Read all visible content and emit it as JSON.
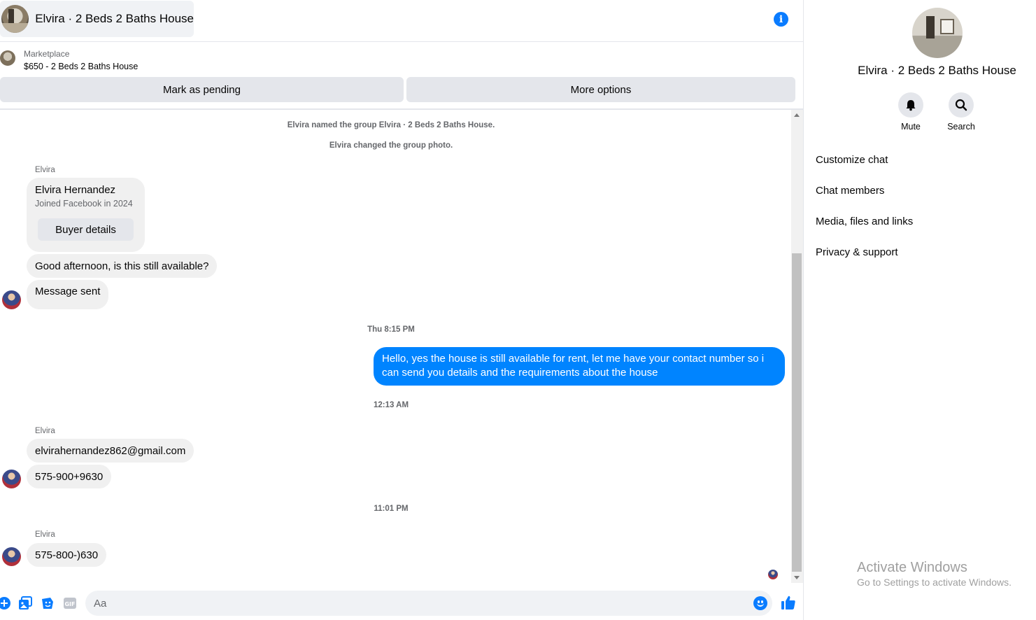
{
  "header": {
    "title": "Elvira · 2 Beds 2 Baths House"
  },
  "listing": {
    "label": "Marketplace",
    "price_title": "$650 - 2 Beds 2 Baths House"
  },
  "actions": {
    "pending_label": "Mark as pending",
    "more_label": "More options"
  },
  "messages": {
    "system_1": "Elvira named the group Elvira · 2 Beds 2 Baths House.",
    "system_2": "Elvira changed the group photo.",
    "sender_name": "Elvira",
    "card": {
      "name": "Elvira Hernandez",
      "subtitle": "Joined Facebook in 2024",
      "button": "Buyer details"
    },
    "msg_1": "Good afternoon, is this still available?",
    "msg_2": "Message sent",
    "time_1": "Thu 8:15 PM",
    "outgoing_1": "Hello, yes the house is still available for rent, let me have your contact number so i can send you details and the requirements about the house",
    "time_2": "12:13 AM",
    "msg_3": "elvirahernandez862@gmail.com",
    "msg_4": "575-900+9630",
    "time_3": "11:01 PM",
    "msg_5": "575-800-)630"
  },
  "composer": {
    "placeholder": "Aa"
  },
  "panel": {
    "title": "Elvira · 2 Beds 2 Baths House",
    "mute_label": "Mute",
    "search_label": "Search",
    "menu": [
      "Customize chat",
      "Chat members",
      "Media, files and links",
      "Privacy & support"
    ]
  },
  "watermark": {
    "line1": "Activate Windows",
    "line2": "Go to Settings to activate Windows."
  },
  "colors": {
    "accent": "#0a7cff",
    "outgoing_bubble": "#0084ff",
    "incoming_bubble": "#f0f0f0"
  }
}
